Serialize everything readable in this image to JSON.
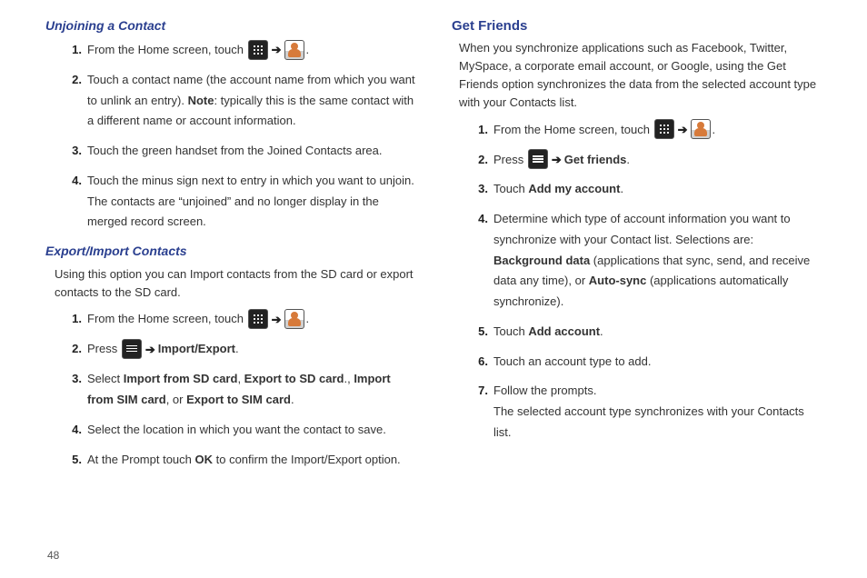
{
  "page_number": "48",
  "left": {
    "h_unjoin": "Unjoining a Contact",
    "unjoin_steps": [
      {
        "pre": "From the Home screen, touch ",
        "icons": [
          "apps",
          "arrow",
          "contact"
        ],
        "post": "."
      },
      {
        "pre": "Touch a contact name (the account name from which you want to unlink an entry). ",
        "bold1": "Note",
        "post": ": typically this is the same contact with a different name or account information."
      },
      {
        "pre": "Touch the green handset from the Joined Contacts area."
      },
      {
        "pre": "Touch the minus sign next to entry in which you want to unjoin. The contacts are “unjoined” and no longer display in the merged record screen."
      }
    ],
    "h_export": "Export/Import Contacts",
    "export_intro": "Using this option you can Import contacts from the SD card or export contacts to the SD card.",
    "export_steps": [
      {
        "pre": "From the Home screen, touch ",
        "icons": [
          "apps",
          "arrow",
          "contact"
        ],
        "post": "."
      },
      {
        "pre": "Press ",
        "icons": [
          "menu",
          "arrow"
        ],
        "bold1": "Import/Export",
        "post": "."
      },
      {
        "pre": "Select ",
        "bold1": "Import from SD card",
        "mid1": ", ",
        "bold2": "Export to SD card",
        "mid2": "., ",
        "bold3": "Import from SIM card",
        "mid3": ", or ",
        "bold4": "Export to SIM card",
        "post": "."
      },
      {
        "pre": "Select the location in which you want the contact to save."
      },
      {
        "pre": "At the Prompt touch ",
        "bold1": "OK",
        "post": " to confirm the Import/Export option."
      }
    ]
  },
  "right": {
    "h_get": "Get Friends",
    "get_intro": "When you synchronize applications such as Facebook, Twitter, MySpace, a corporate email account, or Google, using the Get Friends option synchronizes the data from the selected account type with your Contacts list.",
    "get_steps": [
      {
        "pre": "From the Home screen, touch ",
        "icons": [
          "apps",
          "arrow",
          "contact"
        ],
        "post": "."
      },
      {
        "pre": "Press ",
        "icons": [
          "menu",
          "arrow"
        ],
        "bold1": "Get friends",
        "post": "."
      },
      {
        "pre": "Touch ",
        "bold1": "Add my account",
        "post": "."
      },
      {
        "pre": "Determine which type of account information you want to synchronize with your Contact list. Selections are: ",
        "bold1": "Background data",
        "mid1": " (applications that sync, send, and receive data any time), or ",
        "bold2": "Auto-sync",
        "post": " (applications automatically synchronize)."
      },
      {
        "pre": "Touch ",
        "bold1": "Add account",
        "post": "."
      },
      {
        "pre": "Touch an account type to add."
      },
      {
        "pre": "Follow the prompts.",
        "br": true,
        "post2": "The selected account type synchronizes with your Contacts list."
      }
    ]
  }
}
